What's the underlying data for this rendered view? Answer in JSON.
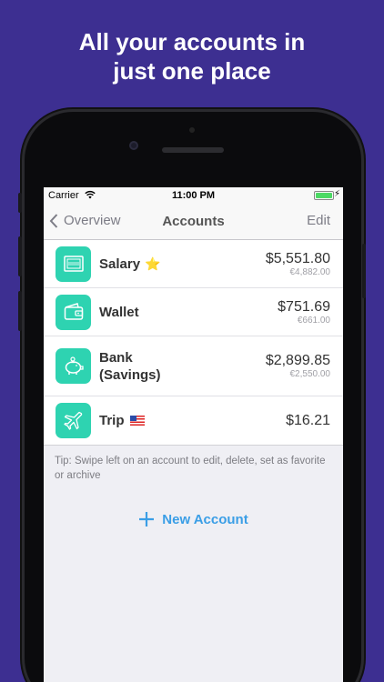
{
  "headline": {
    "line1": "All your accounts in",
    "line2": "just one place"
  },
  "statusbar": {
    "carrier": "Carrier",
    "time": "11:00 PM"
  },
  "navbar": {
    "back_label": "Overview",
    "title": "Accounts",
    "edit_label": "Edit"
  },
  "accounts": [
    {
      "name": "Salary",
      "emoji": "⭐",
      "amount": "$5,551.80",
      "sub_amount": "€4,882.00",
      "icon": "salary-icon"
    },
    {
      "name": "Wallet",
      "emoji": "",
      "amount": "$751.69",
      "sub_amount": "€661.00",
      "icon": "wallet-icon"
    },
    {
      "name_line1": "Bank",
      "name_line2": "(Savings)",
      "amount": "$2,899.85",
      "sub_amount": "€2,550.00",
      "icon": "piggy-bank-icon"
    },
    {
      "name": "Trip",
      "flag": "us-flag-icon",
      "amount": "$16.21",
      "icon": "airplane-icon"
    }
  ],
  "tip": "Tip: Swipe left on an account to edit, delete, set as favorite or archive",
  "new_account_label": "New Account",
  "colors": {
    "background": "#3d2f91",
    "accent": "#3a9ee6",
    "icon_bg": "#2ed3b1"
  }
}
